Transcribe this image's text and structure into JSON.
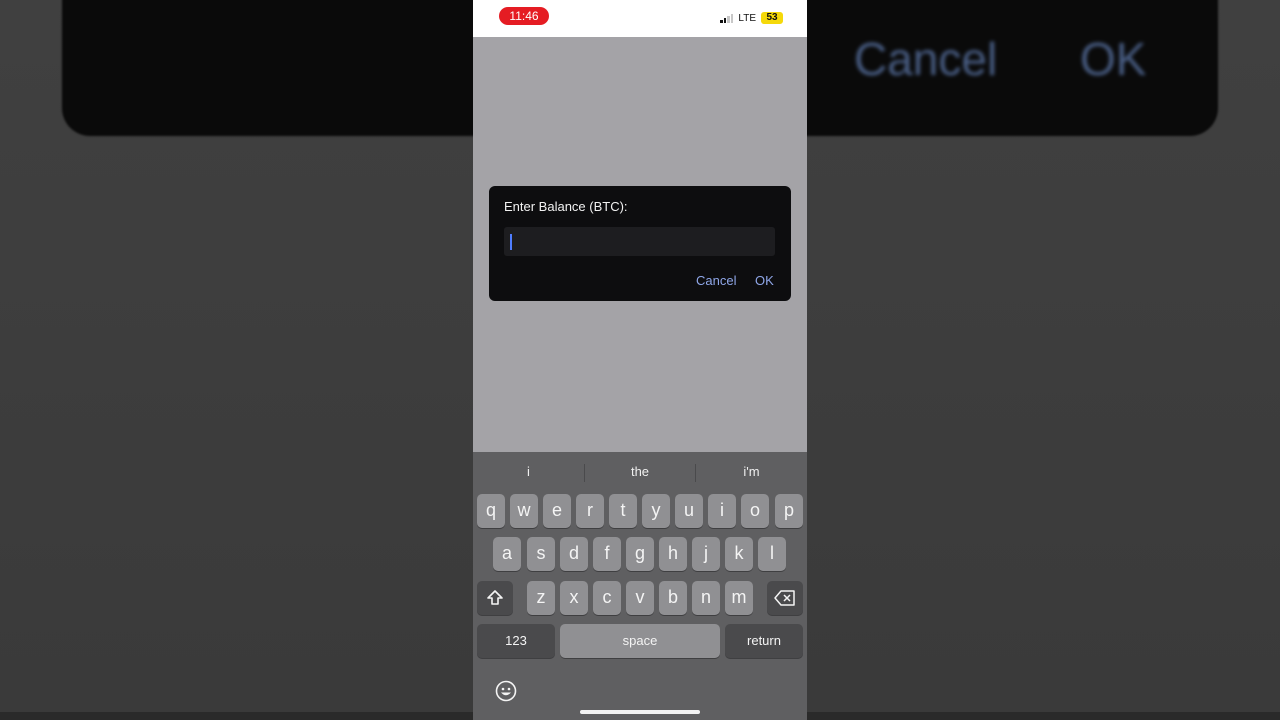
{
  "background": {
    "cancel_label": "Cancel",
    "ok_label": "OK"
  },
  "status_bar": {
    "time": "11:46",
    "network": "LTE",
    "battery": "53"
  },
  "dialog": {
    "title": "Enter Balance (BTC):",
    "input_value": "",
    "cancel_label": "Cancel",
    "ok_label": "OK"
  },
  "keyboard": {
    "suggestions": [
      "i",
      "the",
      "i'm"
    ],
    "row1": [
      "q",
      "w",
      "e",
      "r",
      "t",
      "y",
      "u",
      "i",
      "o",
      "p"
    ],
    "row2": [
      "a",
      "s",
      "d",
      "f",
      "g",
      "h",
      "j",
      "k",
      "l"
    ],
    "row3": [
      "z",
      "x",
      "c",
      "v",
      "b",
      "n",
      "m"
    ],
    "numbers_label": "123",
    "space_label": "space",
    "return_label": "return"
  },
  "colors": {
    "accent": "#8fa6e8",
    "time_pill": "#e51c23",
    "battery": "#f5d90a"
  }
}
